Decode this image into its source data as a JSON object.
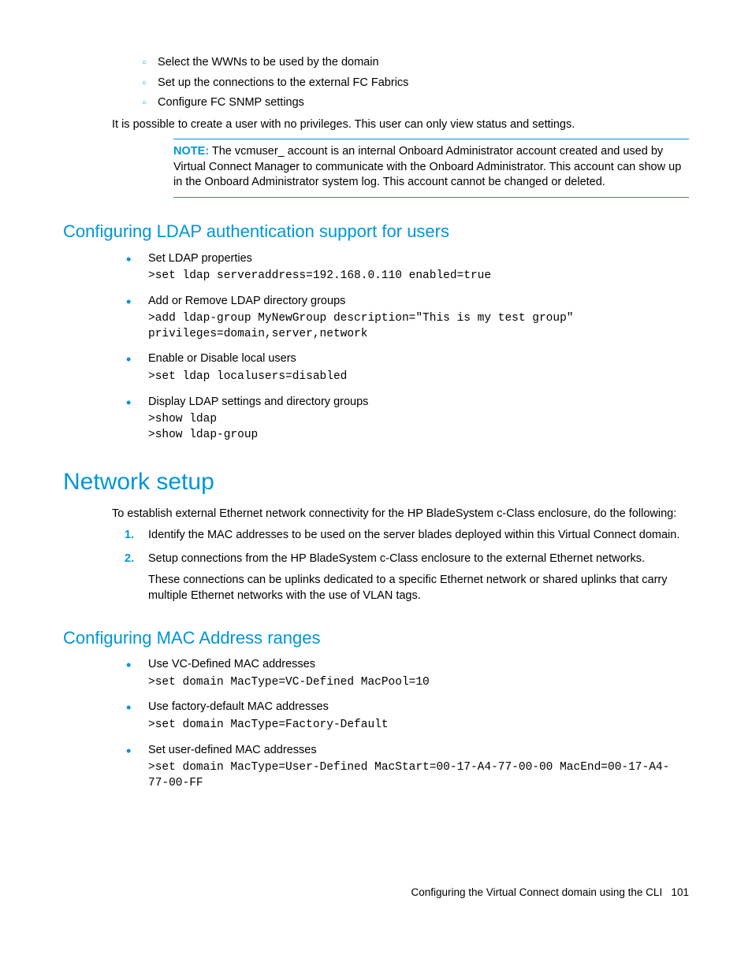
{
  "top_sublist": [
    "Select the WWNs to be used by the domain",
    "Set up the connections to the external FC Fabrics",
    "Configure FC SNMP settings"
  ],
  "privileges_para": "It is possible to create a user with no privileges. This user can only view status and settings.",
  "note": {
    "label": "NOTE:",
    "text": " The vcmuser_ account is an internal Onboard Administrator account created and used by Virtual Connect Manager to communicate with the Onboard Administrator. This account can show up in the Onboard Administrator system log. This account cannot be changed or deleted."
  },
  "ldap": {
    "heading": "Configuring LDAP authentication support for users",
    "items": [
      {
        "label": "Set LDAP properties",
        "code": ">set ldap serveraddress=192.168.0.110 enabled=true"
      },
      {
        "label": "Add or Remove LDAP directory groups",
        "code": ">add ldap-group MyNewGroup description=\"This is my test group\" privileges=domain,server,network"
      },
      {
        "label": "Enable or Disable local users",
        "code": ">set ldap localusers=disabled"
      },
      {
        "label": "Display LDAP settings and directory groups",
        "code": ">show ldap\n>show ldap-group"
      }
    ]
  },
  "network": {
    "heading": "Network setup",
    "intro": "To establish external Ethernet network connectivity for the HP BladeSystem c-Class enclosure, do the following:",
    "steps": [
      {
        "text": "Identify the MAC addresses to be used on the server blades deployed within this Virtual Connect domain."
      },
      {
        "text": "Setup connections from the HP BladeSystem c-Class enclosure to the external Ethernet networks.",
        "extra": "These connections can be uplinks dedicated to a specific Ethernet network or shared uplinks that carry multiple Ethernet networks with the use of VLAN tags."
      }
    ]
  },
  "mac": {
    "heading": "Configuring MAC Address ranges",
    "items": [
      {
        "label": "Use VC-Defined MAC addresses",
        "code": ">set domain MacType=VC-Defined MacPool=10"
      },
      {
        "label": "Use factory-default MAC addresses",
        "code": ">set domain MacType=Factory-Default"
      },
      {
        "label": "Set user-defined MAC addresses",
        "code": ">set domain MacType=User-Defined MacStart=00-17-A4-77-00-00 MacEnd=00-17-A4-77-00-FF"
      }
    ]
  },
  "footer": {
    "text": "Configuring the Virtual Connect domain using the CLI",
    "page": "101"
  }
}
